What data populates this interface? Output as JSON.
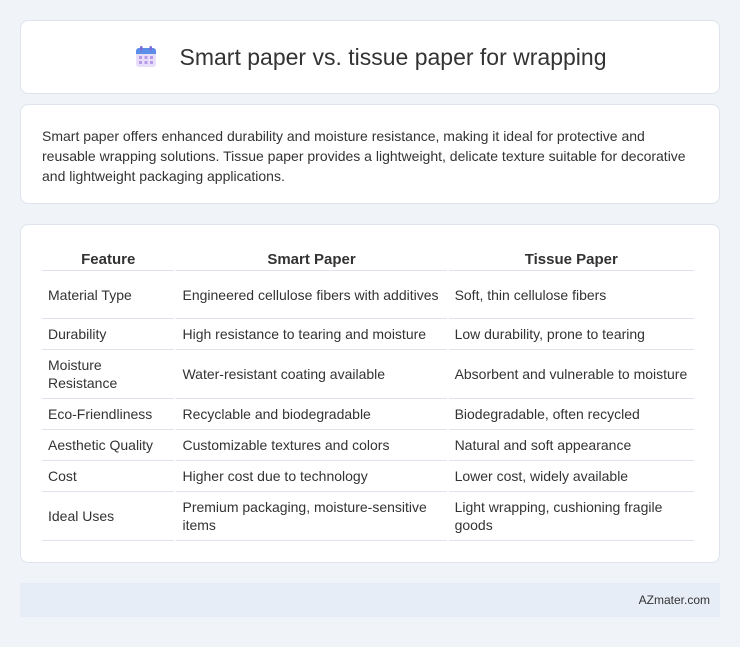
{
  "header": {
    "title": "Smart paper vs. tissue paper for wrapping",
    "icon": "calendar-icon"
  },
  "description": "Smart paper offers enhanced durability and moisture resistance, making it ideal for protective and reusable wrapping solutions. Tissue paper provides a lightweight, delicate texture suitable for decorative and lightweight packaging applications.",
  "table": {
    "headers": [
      "Feature",
      "Smart Paper",
      "Tissue Paper"
    ],
    "rows": [
      [
        "Material Type",
        "Engineered cellulose fibers with additives",
        "Soft, thin cellulose fibers"
      ],
      [
        "Durability",
        "High resistance to tearing and moisture",
        "Low durability, prone to tearing"
      ],
      [
        "Moisture Resistance",
        "Water-resistant coating available",
        "Absorbent and vulnerable to moisture"
      ],
      [
        "Eco-Friendliness",
        "Recyclable and biodegradable",
        "Biodegradable, often recycled"
      ],
      [
        "Aesthetic Quality",
        "Customizable textures and colors",
        "Natural and soft appearance"
      ],
      [
        "Cost",
        "Higher cost due to technology",
        "Lower cost, widely available"
      ],
      [
        "Ideal Uses",
        "Premium packaging, moisture-sensitive items",
        "Light wrapping, cushioning fragile goods"
      ]
    ]
  },
  "footer": {
    "site": "AZmater.com"
  }
}
